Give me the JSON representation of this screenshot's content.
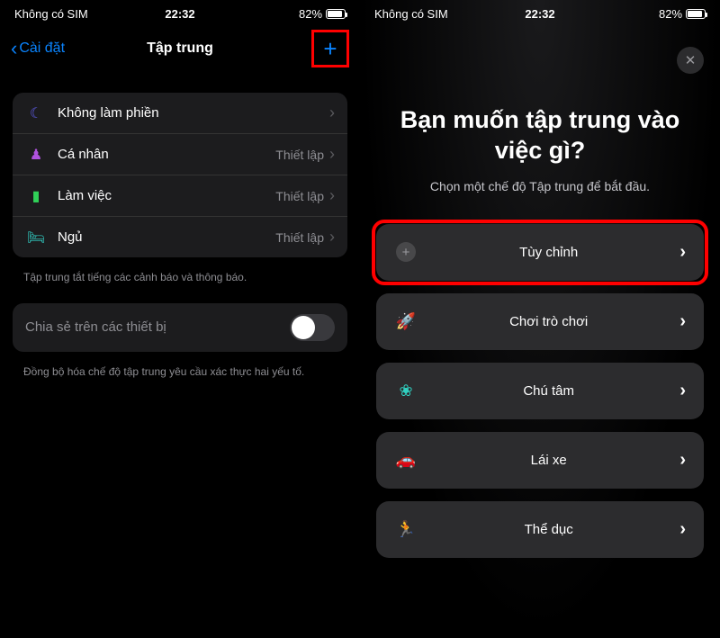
{
  "status": {
    "carrier": "Không có SIM",
    "time": "22:32",
    "battery": "82%"
  },
  "left": {
    "back": "Cài đặt",
    "title": "Tập trung",
    "rows": [
      {
        "label": "Không làm phiền",
        "detail": ""
      },
      {
        "label": "Cá nhân",
        "detail": "Thiết lập"
      },
      {
        "label": "Làm việc",
        "detail": "Thiết lập"
      },
      {
        "label": "Ngủ",
        "detail": "Thiết lập"
      }
    ],
    "footer1": "Tập trung tắt tiếng các cảnh báo và thông báo.",
    "share_label": "Chia sẻ trên các thiết bị",
    "footer2": "Đồng bộ hóa chế độ tập trung yêu cầu xác thực hai yếu tố."
  },
  "right": {
    "title": "Bạn muốn tập trung vào việc gì?",
    "subtitle": "Chọn một chế độ Tập trung để bắt đầu.",
    "options": [
      {
        "label": "Tùy chỉnh"
      },
      {
        "label": "Chơi trò chơi"
      },
      {
        "label": "Chú tâm"
      },
      {
        "label": "Lái xe"
      },
      {
        "label": "Thể dục"
      }
    ]
  }
}
